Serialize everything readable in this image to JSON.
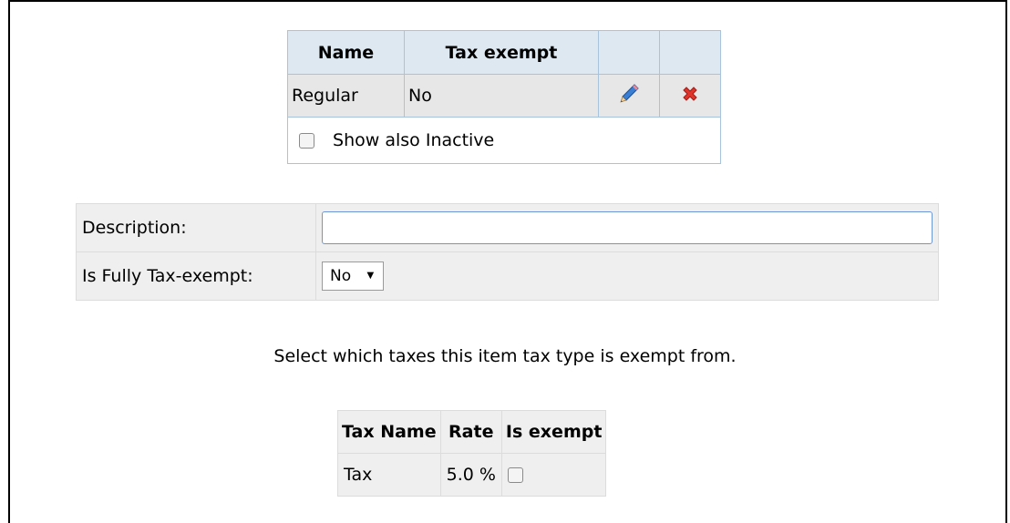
{
  "list_table": {
    "headers": [
      "Name",
      "Tax exempt",
      "",
      ""
    ],
    "rows": [
      {
        "name": "Regular",
        "tax_exempt": "No",
        "edit_icon": "pencil-icon",
        "delete_icon": "x-icon"
      }
    ],
    "show_inactive_label": "Show also Inactive"
  },
  "form": {
    "description_label": "Description:",
    "description_value": "",
    "fully_exempt_label": "Is Fully Tax-exempt:",
    "fully_exempt_value": "No"
  },
  "info_text": "Select which taxes this item tax type is exempt from.",
  "taxes_table": {
    "headers": [
      "Tax Name",
      "Rate",
      "Is exempt"
    ],
    "rows": [
      {
        "name": "Tax",
        "rate": "5.0 %",
        "exempt": false
      }
    ]
  },
  "colors": {
    "header_bg": "#dde8f1",
    "header_border": "#a8c4dc",
    "row_bg": "#e7e7e7",
    "delete_red": "#e0342b",
    "edit_blue": "#3a7fd4"
  }
}
